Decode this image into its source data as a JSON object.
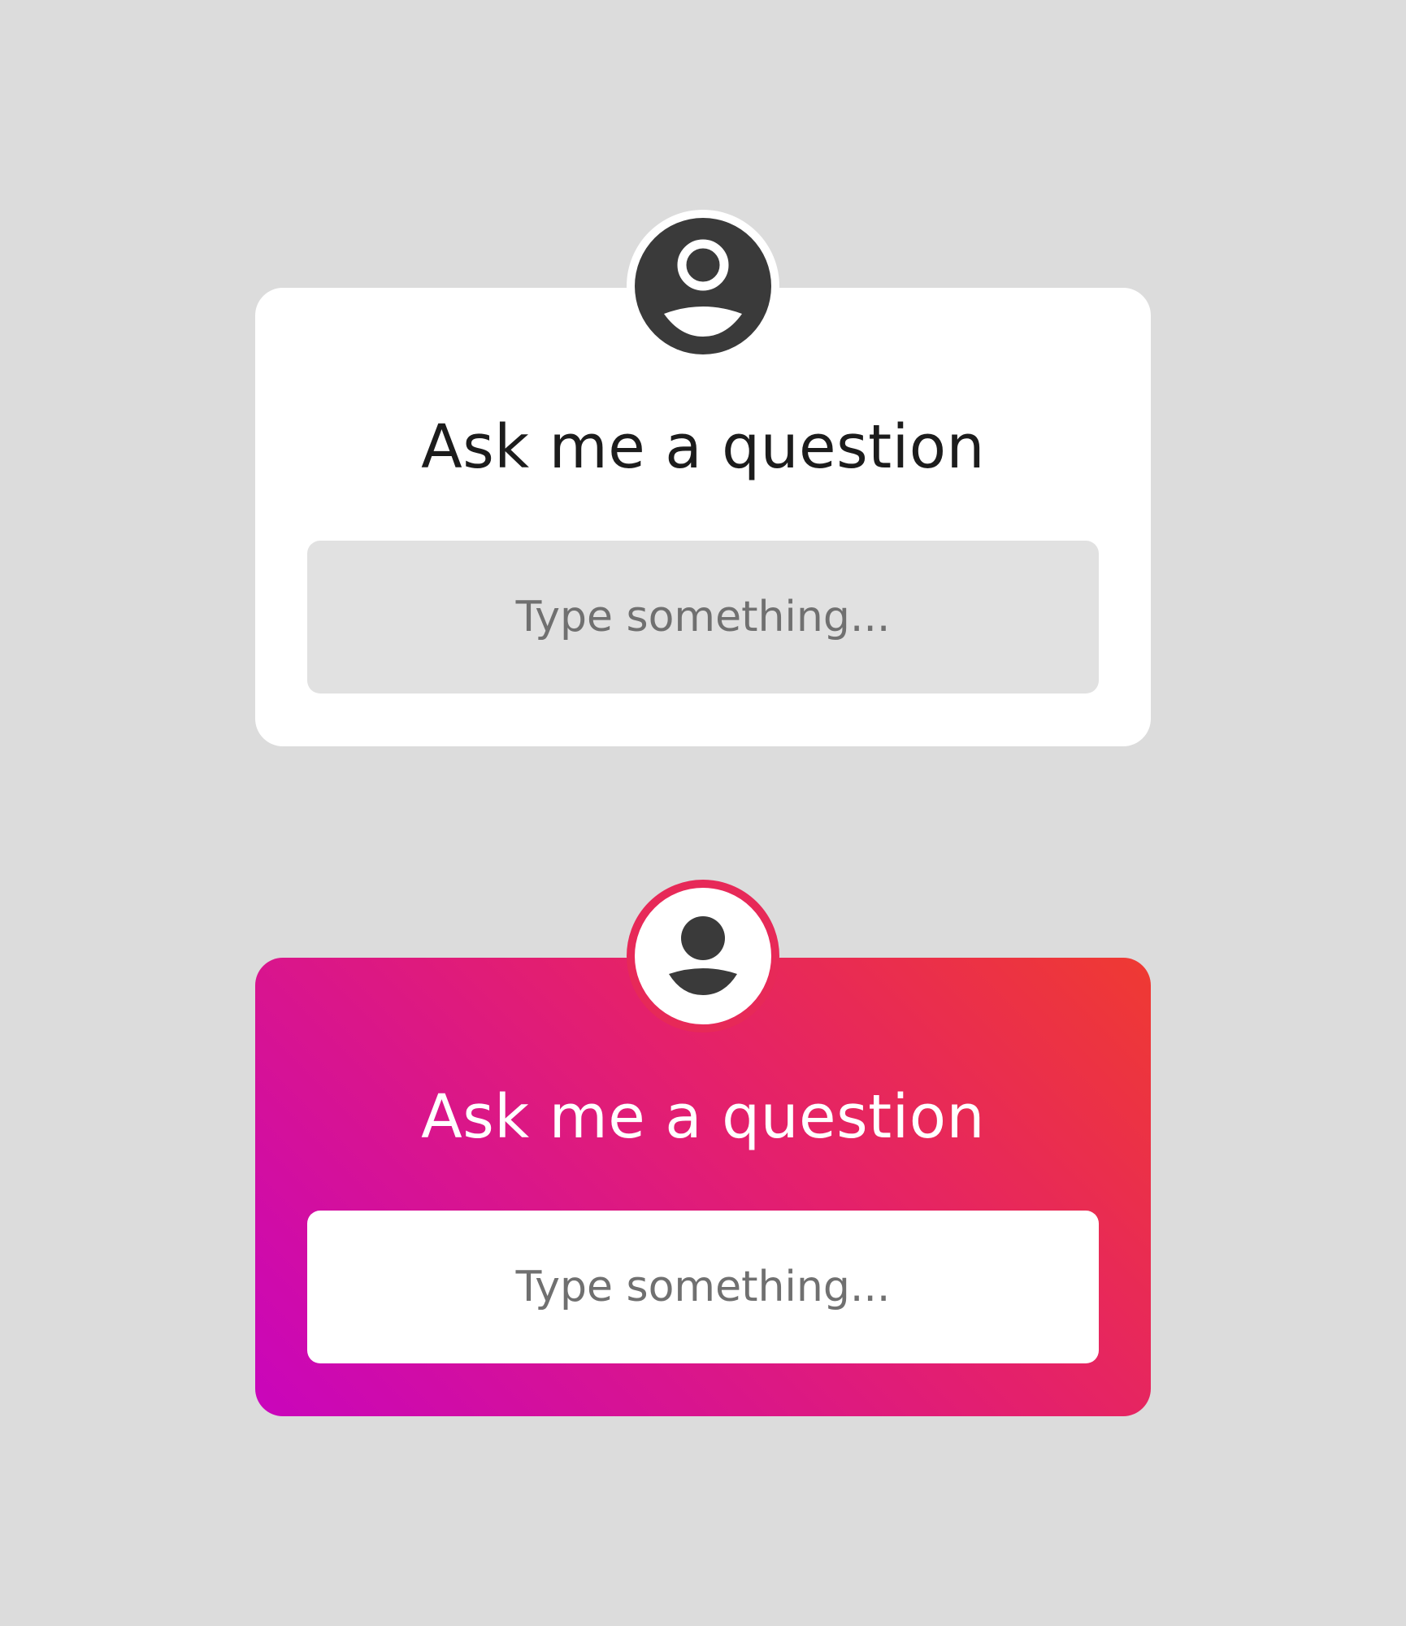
{
  "colors": {
    "background": "#dcdcdc",
    "white_card": "#ffffff",
    "white_card_field": "#e1e1e1",
    "avatar_dark": "#3a3a3a",
    "gradient_start": "#c905bc",
    "gradient_mid": "#e4206c",
    "gradient_end": "#ef3a32",
    "placeholder_text": "#707070"
  },
  "stickers": [
    {
      "variant": "white",
      "avatar_icon": "user-avatar-icon",
      "title": "Ask me a question",
      "input_placeholder": "Type something..."
    },
    {
      "variant": "gradient",
      "avatar_icon": "user-avatar-icon",
      "title": "Ask me a question",
      "input_placeholder": "Type something..."
    }
  ]
}
